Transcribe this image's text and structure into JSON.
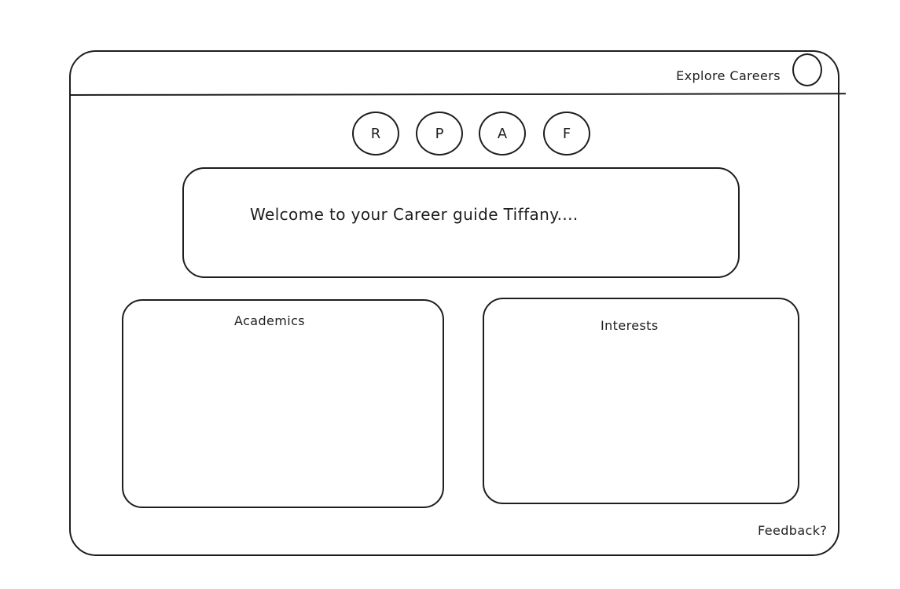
{
  "header": {
    "nav_link": "Explore Careers",
    "avatar_icon": "profile-circle-icon"
  },
  "section_buttons": [
    {
      "label": "R"
    },
    {
      "label": "P"
    },
    {
      "label": "A"
    },
    {
      "label": "F"
    }
  ],
  "welcome": {
    "message": "Welcome to your Career guide Tiffany...."
  },
  "panels": {
    "academics_title": "Academics",
    "interests_title": "Interests"
  },
  "footer": {
    "feedback_link": "Feedback?"
  },
  "colors": {
    "stroke": "#1e1e1e",
    "background": "#ffffff"
  }
}
